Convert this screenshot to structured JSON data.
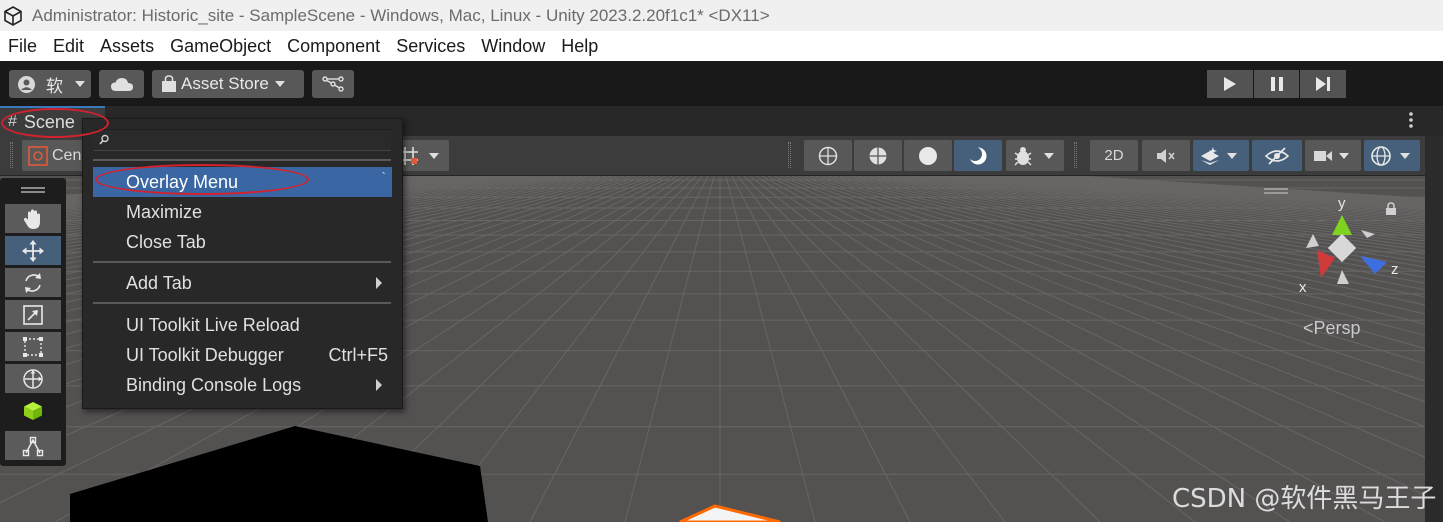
{
  "window": {
    "title": "Administrator: Historic_site - SampleScene - Windows, Mac, Linux - Unity 2023.2.20f1c1* <DX11>"
  },
  "menubar": {
    "items": [
      "File",
      "Edit",
      "Assets",
      "GameObject",
      "Component",
      "Services",
      "Window",
      "Help"
    ]
  },
  "toolbar": {
    "account_label": "软",
    "asset_store_label": "Asset Store",
    "icons": [
      "account-icon",
      "cloud-icon",
      "shopping-bag-icon",
      "version-control-icon",
      "play-icon",
      "pause-icon",
      "step-icon"
    ]
  },
  "scene_tab": {
    "label": "Scene",
    "pivot_label": "Cen"
  },
  "scene_toolbar": {
    "toggle_2d_label": "2D",
    "icons": [
      "wireframe-icon",
      "shaded-wireframe-icon",
      "shaded-icon",
      "lighting-icon",
      "debug-icon",
      "audio-mute-icon",
      "effects-icon",
      "visibility-icon",
      "camera-icon",
      "gizmos-icon",
      "grid-snap-icon"
    ]
  },
  "tools_panel": {
    "tools": [
      "hand-tool-icon",
      "move-tool-icon",
      "rotate-tool-icon",
      "scale-tool-icon",
      "rect-tool-icon",
      "transform-tool-icon",
      "custom-cube-tool-icon",
      "spline-tool-icon"
    ],
    "active_tool": "move-tool-icon"
  },
  "context_menu": {
    "items": [
      {
        "label": "Overlay Menu",
        "shortcut": "`",
        "highlighted": true
      },
      {
        "label": "Maximize"
      },
      {
        "label": "Close Tab"
      },
      {
        "label": "Add Tab",
        "submenu": true
      },
      {
        "label": "UI Toolkit Live Reload"
      },
      {
        "label": "UI Toolkit Debugger",
        "shortcut": "Ctrl+F5"
      },
      {
        "label": "Binding Console Logs",
        "submenu": true
      }
    ]
  },
  "gizmo": {
    "axis_y": "y",
    "axis_x": "x",
    "axis_z": "z",
    "view_label": "Persp"
  },
  "watermark": "CSDN @软件黑马王子",
  "colors": {
    "highlight": "#3a67a3",
    "annotation": "#d2222e",
    "axis_x": "#d03a3a",
    "axis_y": "#7ed321",
    "axis_z": "#3d6fe0",
    "selection_outline": "#ff6a00"
  }
}
